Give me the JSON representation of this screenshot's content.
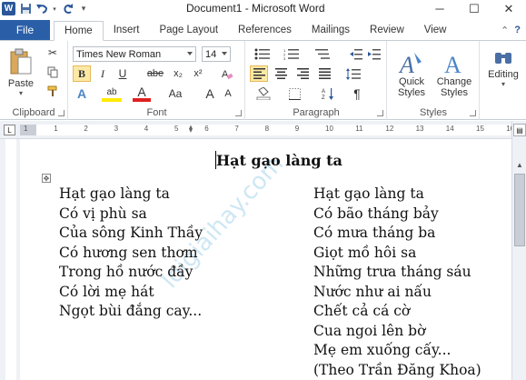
{
  "window": {
    "title": "Document1 - Microsoft Word",
    "app_icon": "W",
    "controls": [
      "minimize-icon",
      "maximize-icon",
      "close-icon"
    ]
  },
  "quick_access": [
    "save-icon",
    "undo-icon",
    "redo-icon",
    "customize-icon"
  ],
  "tabs": {
    "file": "File",
    "items": [
      "Home",
      "Insert",
      "Page Layout",
      "References",
      "Mailings",
      "Review",
      "View"
    ],
    "active": "Home"
  },
  "ribbon": {
    "clipboard": {
      "paste": "Paste",
      "label": "Clipboard"
    },
    "font": {
      "name": "Times New Roman",
      "size": "14",
      "bold": "B",
      "italic": "I",
      "underline": "U",
      "strike": "abe",
      "subscript": "x₂",
      "superscript": "x²",
      "text_effects": "A",
      "highlight": "ab",
      "font_color": "A",
      "change_case": "Aa",
      "grow": "A",
      "shrink": "A",
      "label": "Font"
    },
    "paragraph": {
      "label": "Paragraph",
      "pilcrow": "¶"
    },
    "styles": {
      "quick": "Quick",
      "quick2": "Styles",
      "change": "Change",
      "change2": "Styles",
      "label": "Styles"
    },
    "editing": {
      "label": "Editing"
    }
  },
  "ruler": {
    "numbers": [
      "1",
      "1",
      "2",
      "3",
      "4",
      "5",
      "6",
      "7",
      "8",
      "9",
      "10",
      "11",
      "12",
      "13",
      "14",
      "15",
      "16"
    ]
  },
  "document": {
    "title": "Hạt gạo làng ta",
    "left_column": [
      "Hạt gạo làng ta",
      "Có vị phù sa",
      "Của sông Kinh Thầy",
      "Có hương sen thơm",
      "Trong hồ nước đầy",
      "Có lời mẹ hát",
      "Ngọt bùi đắng cay..."
    ],
    "right_column": [
      "Hạt gạo làng ta",
      "Có bão tháng bảy",
      "Có mưa tháng ba",
      "Giọt mồ hôi sa",
      "Những trưa tháng sáu",
      "Nước như ai nấu",
      "Chết cả cá cờ",
      "Cua ngoi lên bờ",
      "Mẹ em xuống cấy...",
      "(Theo Trần Đăng Khoa)"
    ]
  },
  "watermark": "loigiaihay.com"
}
